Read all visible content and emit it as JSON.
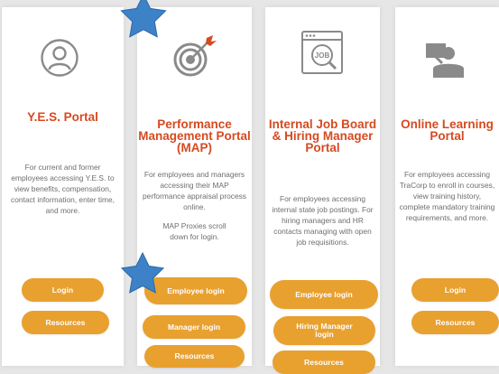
{
  "cards": [
    {
      "title": "Y.E.S. Portal",
      "description": "For current and former employees accessing Y.E.S. to view benefits, compensation, contact information, enter time, and more.",
      "buttons": [
        "Login",
        "Resources"
      ]
    },
    {
      "title": "Performance Management Portal (MAP)",
      "description": "For employees and managers accessing their MAP performance appraisal process online.",
      "note": "MAP Proxies scroll down for login.",
      "buttons": [
        "Employee login",
        "Manager login",
        "Resources"
      ]
    },
    {
      "title": "Internal Job Board & Hiring Manager Portal",
      "description": "For employees accessing internal state job postings. For hiring managers and HR contacts managing with open job requisitions.",
      "buttons": [
        "Employee login",
        "Hiring Manager login",
        "Resources"
      ]
    },
    {
      "title": "Online Learning Portal",
      "description": "For employees accessing TraCorp to enroll in courses, view training history, complete mandatory training requirements, and more.",
      "buttons": [
        "Login",
        "Resources"
      ]
    }
  ],
  "icons": {
    "card1": "user-circle-icon",
    "card2": "target-icon",
    "card3": "job-search-icon",
    "card4": "instructor-icon",
    "annotation": "star-icon"
  },
  "colors": {
    "title": "#d64a1f",
    "button": "#e8a02f",
    "star": "#3d82c6",
    "text": "#6e6e6e"
  }
}
